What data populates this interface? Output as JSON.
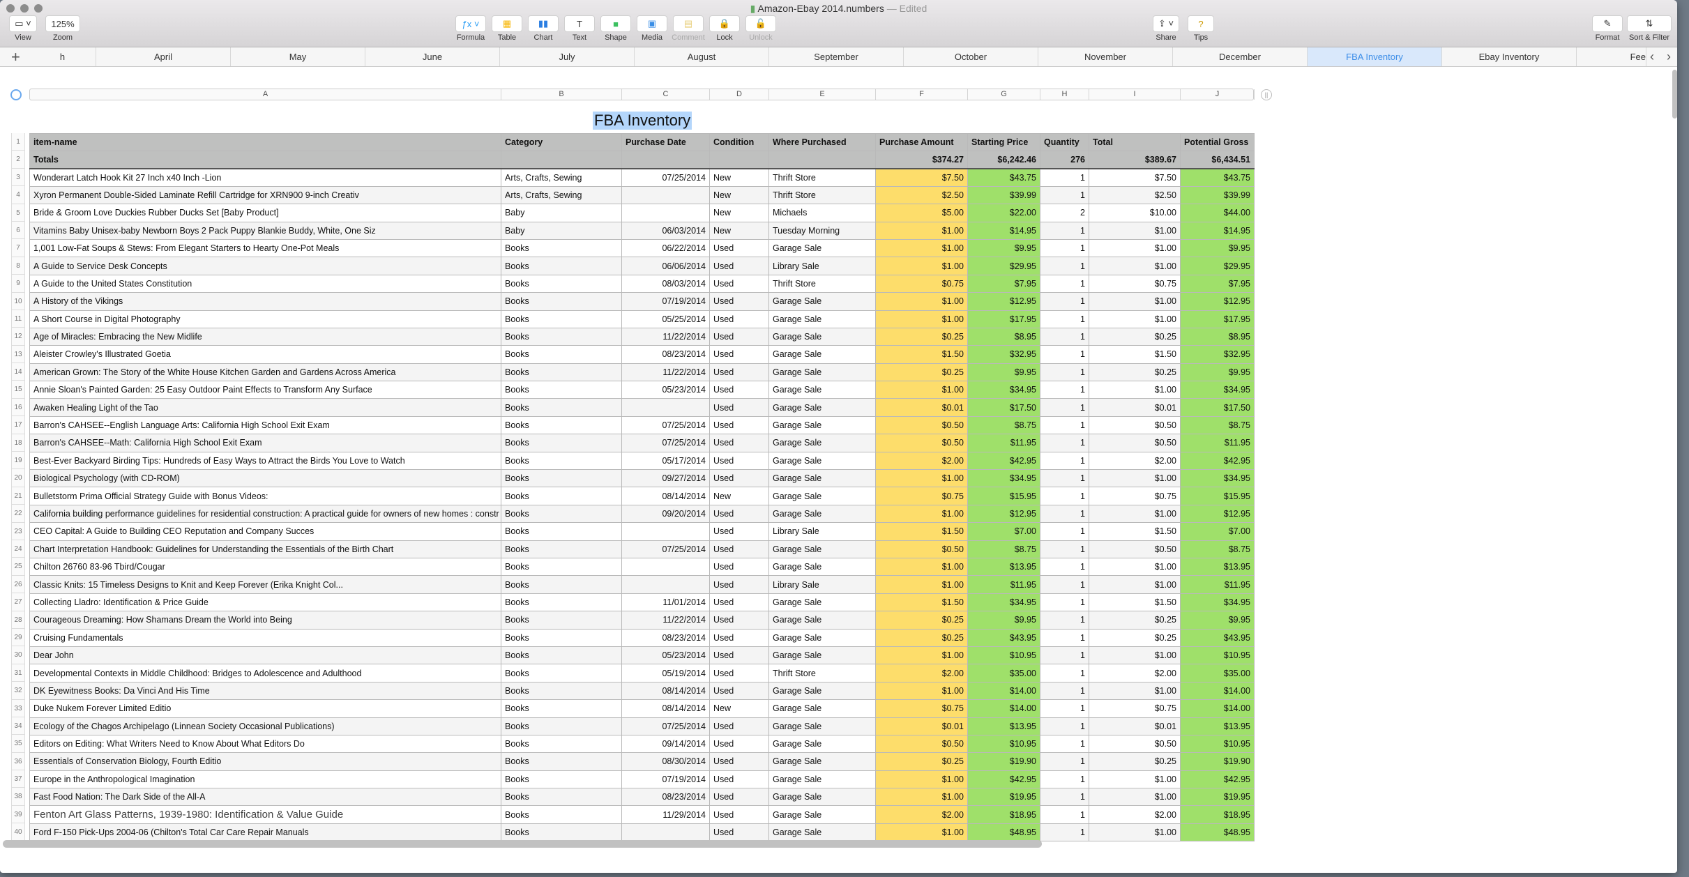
{
  "window": {
    "filename": "Amazon-Ebay 2014.numbers",
    "status": "Edited"
  },
  "toolbar": {
    "left": [
      {
        "label": "View",
        "icon": "sidebar-icon"
      },
      {
        "label": "Zoom",
        "value": "125%"
      }
    ],
    "center": [
      {
        "label": "Formula",
        "icon": "fx"
      },
      {
        "label": "Table",
        "icon": "table-icon"
      },
      {
        "label": "Chart",
        "icon": "chart-icon"
      },
      {
        "label": "Text",
        "icon": "T"
      },
      {
        "label": "Shape",
        "icon": "shape-icon"
      },
      {
        "label": "Media",
        "icon": "media-icon"
      },
      {
        "label": "Comment",
        "icon": "comment-icon",
        "disabled": true
      },
      {
        "label": "Lock",
        "icon": "lock-icon"
      },
      {
        "label": "Unlock",
        "icon": "unlock-icon",
        "disabled": true
      }
    ],
    "share": {
      "label": "Share"
    },
    "tips": {
      "label": "Tips",
      "icon": "?"
    },
    "right": [
      {
        "label": "Format"
      },
      {
        "label": "Sort & Filter"
      }
    ]
  },
  "sheet_tabs": [
    "h",
    "April",
    "May",
    "June",
    "July",
    "August",
    "September",
    "October",
    "November",
    "December",
    "FBA Inventory",
    "Ebay Inventory",
    "Fee"
  ],
  "active_tab": "FBA Inventory",
  "column_letters": [
    "A",
    "B",
    "C",
    "D",
    "E",
    "F",
    "G",
    "H",
    "I",
    "J"
  ],
  "table": {
    "title": "FBA Inventory",
    "headers": [
      "item-name",
      "Category",
      "Purchase Date",
      "Condition",
      "Where Purchased",
      "Purchase Amount",
      "Starting Price",
      "Quantity",
      "Total",
      "Potential Gross"
    ],
    "totals": [
      "Totals",
      "",
      "",
      "",
      "",
      "$374.27",
      "$6,242.46",
      "276",
      "$389.67",
      "$6,434.51"
    ],
    "colors": {
      "purchase_amount": "#fddd6b",
      "starting_price": "#9fe06a",
      "potential_gross": "#9fe06a"
    },
    "rows": [
      [
        "Wonderart Latch Hook Kit 27 Inch x40 Inch -Lion",
        "Arts, Crafts, Sewing",
        "07/25/2014",
        "New",
        "Thrift Store",
        "$7.50",
        "$43.75",
        "1",
        "$7.50",
        "$43.75"
      ],
      [
        "Xyron Permanent Double-Sided Laminate Refill Cartridge for XRN900 9-inch Creativ",
        "Arts, Crafts, Sewing",
        "",
        "New",
        "Thrift Store",
        "$2.50",
        "$39.99",
        "1",
        "$2.50",
        "$39.99"
      ],
      [
        "Bride & Groom Love Duckies Rubber Ducks Set [Baby Product]",
        "Baby",
        "",
        "New",
        "Michaels",
        "$5.00",
        "$22.00",
        "2",
        "$10.00",
        "$44.00"
      ],
      [
        "Vitamins Baby Unisex-baby Newborn Boys 2 Pack Puppy Blankie Buddy, White, One Siz",
        "Baby",
        "06/03/2014",
        "New",
        "Tuesday Morning",
        "$1.00",
        "$14.95",
        "1",
        "$1.00",
        "$14.95"
      ],
      [
        "1,001 Low-Fat Soups & Stews: From Elegant Starters to Hearty One-Pot Meals",
        "Books",
        "06/22/2014",
        "Used",
        "Garage Sale",
        "$1.00",
        "$9.95",
        "1",
        "$1.00",
        "$9.95"
      ],
      [
        "A Guide to Service Desk Concepts",
        "Books",
        "06/06/2014",
        "Used",
        "Library Sale",
        "$1.00",
        "$29.95",
        "1",
        "$1.00",
        "$29.95"
      ],
      [
        "A Guide to the United States Constitution",
        "Books",
        "08/03/2014",
        "Used",
        "Thrift Store",
        "$0.75",
        "$7.95",
        "1",
        "$0.75",
        "$7.95"
      ],
      [
        "A History of the Vikings",
        "Books",
        "07/19/2014",
        "Used",
        "Garage Sale",
        "$1.00",
        "$12.95",
        "1",
        "$1.00",
        "$12.95"
      ],
      [
        "A Short Course in Digital Photography",
        "Books",
        "05/25/2014",
        "Used",
        "Garage Sale",
        "$1.00",
        "$17.95",
        "1",
        "$1.00",
        "$17.95"
      ],
      [
        "Age of Miracles: Embracing the New Midlife",
        "Books",
        "11/22/2014",
        "Used",
        "Garage Sale",
        "$0.25",
        "$8.95",
        "1",
        "$0.25",
        "$8.95"
      ],
      [
        "Aleister Crowley's Illustrated Goetia",
        "Books",
        "08/23/2014",
        "Used",
        "Garage Sale",
        "$1.50",
        "$32.95",
        "1",
        "$1.50",
        "$32.95"
      ],
      [
        "American Grown: The Story of the White House Kitchen Garden and Gardens Across America",
        "Books",
        "11/22/2014",
        "Used",
        "Garage Sale",
        "$0.25",
        "$9.95",
        "1",
        "$0.25",
        "$9.95"
      ],
      [
        "Annie Sloan's Painted Garden: 25 Easy Outdoor Paint Effects to Transform Any Surface",
        "Books",
        "05/23/2014",
        "Used",
        "Garage Sale",
        "$1.00",
        "$34.95",
        "1",
        "$1.00",
        "$34.95"
      ],
      [
        "Awaken Healing Light of the Tao",
        "Books",
        "",
        "Used",
        "Garage Sale",
        "$0.01",
        "$17.50",
        "1",
        "$0.01",
        "$17.50"
      ],
      [
        "Barron's CAHSEE--English Language Arts: California High School Exit Exam",
        "Books",
        "07/25/2014",
        "Used",
        "Garage Sale",
        "$0.50",
        "$8.75",
        "1",
        "$0.50",
        "$8.75"
      ],
      [
        "Barron's CAHSEE--Math: California High School Exit Exam",
        "Books",
        "07/25/2014",
        "Used",
        "Garage Sale",
        "$0.50",
        "$11.95",
        "1",
        "$0.50",
        "$11.95"
      ],
      [
        "Best-Ever Backyard Birding Tips: Hundreds of Easy Ways to Attract the Birds You Love to Watch",
        "Books",
        "05/17/2014",
        "Used",
        "Garage Sale",
        "$2.00",
        "$42.95",
        "1",
        "$2.00",
        "$42.95"
      ],
      [
        "Biological Psychology (with CD-ROM)",
        "Books",
        "09/27/2014",
        "Used",
        "Garage Sale",
        "$1.00",
        "$34.95",
        "1",
        "$1.00",
        "$34.95"
      ],
      [
        "Bulletstorm Prima Official Strategy Guide with Bonus Videos:",
        "Books",
        "08/14/2014",
        "New",
        "Garage Sale",
        "$0.75",
        "$15.95",
        "1",
        "$0.75",
        "$15.95"
      ],
      [
        "California building performance guidelines for residential construction: A practical guide for owners of new homes : constr",
        "Books",
        "09/20/2014",
        "Used",
        "Garage Sale",
        "$1.00",
        "$12.95",
        "1",
        "$1.00",
        "$12.95"
      ],
      [
        "CEO Capital: A Guide to Building CEO Reputation and Company Succes",
        "Books",
        "",
        "Used",
        "Library Sale",
        "$1.50",
        "$7.00",
        "1",
        "$1.50",
        "$7.00"
      ],
      [
        "Chart Interpretation Handbook: Guidelines for Understanding the Essentials of the Birth Chart",
        "Books",
        "07/25/2014",
        "Used",
        "Garage Sale",
        "$0.50",
        "$8.75",
        "1",
        "$0.50",
        "$8.75"
      ],
      [
        "Chilton 26760 83-96 Tbird/Cougar",
        "Books",
        "",
        "Used",
        "Garage Sale",
        "$1.00",
        "$13.95",
        "1",
        "$1.00",
        "$13.95"
      ],
      [
        "Classic Knits: 15 Timeless Designs to Knit and Keep Forever (Erika Knight Col...",
        "Books",
        "",
        "Used",
        "Library Sale",
        "$1.00",
        "$11.95",
        "1",
        "$1.00",
        "$11.95"
      ],
      [
        "Collecting Lladro: Identification & Price Guide",
        "Books",
        "11/01/2014",
        "Used",
        "Garage Sale",
        "$1.50",
        "$34.95",
        "1",
        "$1.50",
        "$34.95"
      ],
      [
        "Courageous Dreaming: How Shamans Dream the World into Being",
        "Books",
        "11/22/2014",
        "Used",
        "Garage Sale",
        "$0.25",
        "$9.95",
        "1",
        "$0.25",
        "$9.95"
      ],
      [
        "Cruising Fundamentals",
        "Books",
        "08/23/2014",
        "Used",
        "Garage Sale",
        "$0.25",
        "$43.95",
        "1",
        "$0.25",
        "$43.95"
      ],
      [
        "Dear John",
        "Books",
        "05/23/2014",
        "Used",
        "Garage Sale",
        "$1.00",
        "$10.95",
        "1",
        "$1.00",
        "$10.95"
      ],
      [
        "Developmental Contexts in Middle Childhood: Bridges to Adolescence and Adulthood",
        "Books",
        "05/19/2014",
        "Used",
        "Thrift Store",
        "$2.00",
        "$35.00",
        "1",
        "$2.00",
        "$35.00"
      ],
      [
        "DK Eyewitness Books: Da Vinci And His Time",
        "Books",
        "08/14/2014",
        "Used",
        "Garage Sale",
        "$1.00",
        "$14.00",
        "1",
        "$1.00",
        "$14.00"
      ],
      [
        "Duke Nukem Forever Limited Editio",
        "Books",
        "08/14/2014",
        "New",
        "Garage Sale",
        "$0.75",
        "$14.00",
        "1",
        "$0.75",
        "$14.00"
      ],
      [
        "Ecology of the Chagos Archipelago (Linnean Society Occasional Publications)",
        "Books",
        "07/25/2014",
        "Used",
        "Garage Sale",
        "$0.01",
        "$13.95",
        "1",
        "$0.01",
        "$13.95"
      ],
      [
        "Editors on Editing: What Writers Need to Know About What Editors Do",
        "Books",
        "09/14/2014",
        "Used",
        "Garage Sale",
        "$0.50",
        "$10.95",
        "1",
        "$0.50",
        "$10.95"
      ],
      [
        "Essentials of Conservation Biology, Fourth Editio",
        "Books",
        "08/30/2014",
        "Used",
        "Garage Sale",
        "$0.25",
        "$19.90",
        "1",
        "$0.25",
        "$19.90"
      ],
      [
        "Europe in the Anthropological Imagination",
        "Books",
        "07/19/2014",
        "Used",
        "Garage Sale",
        "$1.00",
        "$42.95",
        "1",
        "$1.00",
        "$42.95"
      ],
      [
        "Fast Food Nation: The Dark Side of the All-A",
        "Books",
        "08/23/2014",
        "Used",
        "Garage Sale",
        "$1.00",
        "$19.95",
        "1",
        "$1.00",
        "$19.95"
      ],
      [
        "Fenton Art Glass Patterns, 1939-1980: Identification & Value Guide",
        "Books",
        "11/29/2014",
        "Used",
        "Garage Sale",
        "$2.00",
        "$18.95",
        "1",
        "$2.00",
        "$18.95"
      ],
      [
        "Ford F-150 Pick-Ups 2004-06 (Chilton's Total Car Care Repair Manuals",
        "Books",
        "",
        "Used",
        "Garage Sale",
        "$1.00",
        "$48.95",
        "1",
        "$1.00",
        "$48.95"
      ]
    ]
  }
}
